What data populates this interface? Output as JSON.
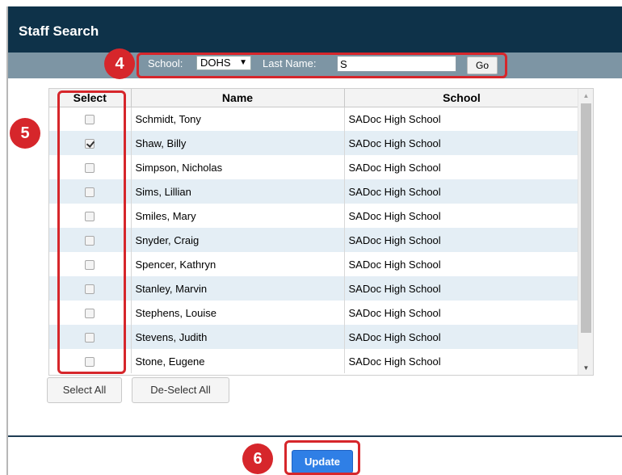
{
  "header": {
    "title": "Staff Search"
  },
  "filter": {
    "school_label": "School:",
    "school_value": "DOHS",
    "lastname_label": "Last Name:",
    "lastname_value": "S",
    "go_label": "Go"
  },
  "markers": {
    "filter": "4",
    "select": "5",
    "update": "6"
  },
  "grid": {
    "columns": [
      "Select",
      "Name",
      "School"
    ],
    "rows": [
      {
        "name": "Schmidt, Tony",
        "school": "SADoc High School",
        "checked": false
      },
      {
        "name": "Shaw, Billy",
        "school": "SADoc High School",
        "checked": true
      },
      {
        "name": "Simpson, Nicholas",
        "school": "SADoc High School",
        "checked": false
      },
      {
        "name": "Sims, Lillian",
        "school": "SADoc High School",
        "checked": false
      },
      {
        "name": "Smiles, Mary",
        "school": "SADoc High School",
        "checked": false
      },
      {
        "name": "Snyder, Craig",
        "school": "SADoc High School",
        "checked": false
      },
      {
        "name": "Spencer, Kathryn",
        "school": "SADoc High School",
        "checked": false
      },
      {
        "name": "Stanley, Marvin",
        "school": "SADoc High School",
        "checked": false
      },
      {
        "name": "Stephens, Louise",
        "school": "SADoc High School",
        "checked": false
      },
      {
        "name": "Stevens, Judith",
        "school": "SADoc High School",
        "checked": false
      },
      {
        "name": "Stone, Eugene",
        "school": "SADoc High School",
        "checked": false
      }
    ]
  },
  "actions": {
    "select_all": "Select All",
    "deselect_all": "De-Select All",
    "update": "Update"
  },
  "colors": {
    "title_bar": "#0e3249",
    "filter_bar": "#7d95a4",
    "highlight": "#d6262b",
    "row_alt": "#e4eef5",
    "update_button": "#2f7fe6"
  }
}
